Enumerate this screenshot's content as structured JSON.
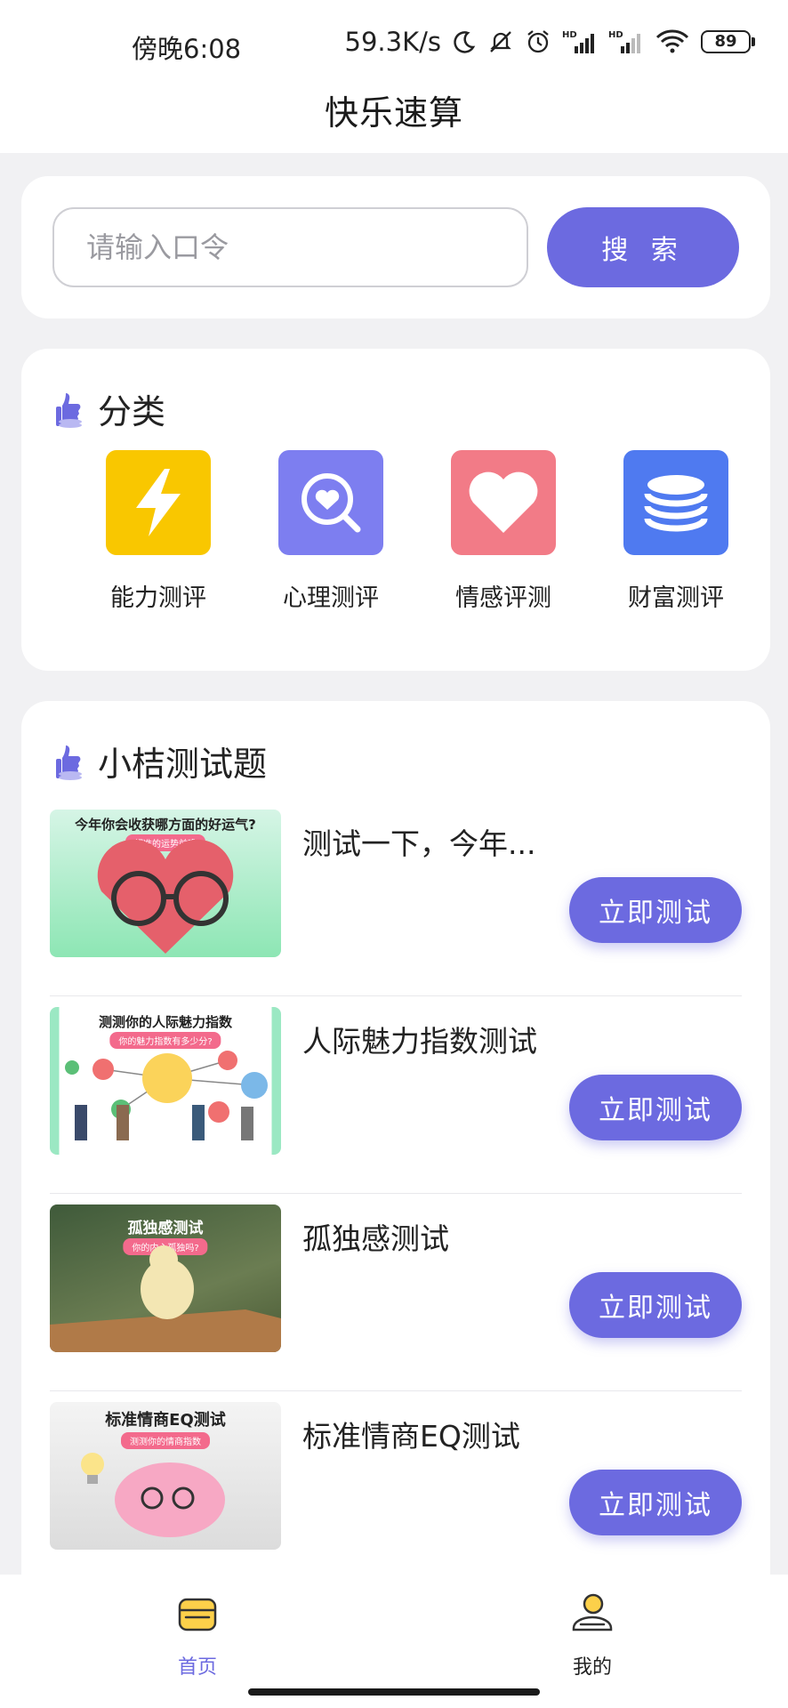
{
  "status": {
    "time": "傍晚6:08",
    "speed": "59.3K/s",
    "battery": "89"
  },
  "app": {
    "title": "快乐速算"
  },
  "search": {
    "placeholder": "请输入口令",
    "button_label": "搜 索"
  },
  "categories": {
    "heading": "分类",
    "items": [
      {
        "label": "能力测评",
        "icon": "lightning-icon",
        "color": "#f9c700"
      },
      {
        "label": "心理测评",
        "icon": "heart-magnifier-icon",
        "color": "#7d7ef0"
      },
      {
        "label": "情感评测",
        "icon": "heart-icon",
        "color": "#f27b87"
      },
      {
        "label": "财富测评",
        "icon": "coins-stack-icon",
        "color": "#4f7af0"
      }
    ]
  },
  "quizzes": {
    "heading": "小桔测试题",
    "action_label": "立即测试",
    "items": [
      {
        "title": "测试一下，今年...",
        "thumb_title": "今年你会收获哪方面的好运气?",
        "thumb_sub": "超准的运势前瞻"
      },
      {
        "title": "人际魅力指数测试",
        "thumb_title": "测测你的人际魅力指数",
        "thumb_sub": "你的魅力指数有多少分?"
      },
      {
        "title": "孤独感测试",
        "thumb_title": "孤独感测试",
        "thumb_sub": "你的内心孤独吗?"
      },
      {
        "title": "标准情商EQ测试",
        "thumb_title": "标准情商EQ测试",
        "thumb_sub": "测测你的情商指数"
      }
    ]
  },
  "tabbar": {
    "home": "首页",
    "me": "我的"
  },
  "colors": {
    "accent": "#6c6ae0"
  }
}
